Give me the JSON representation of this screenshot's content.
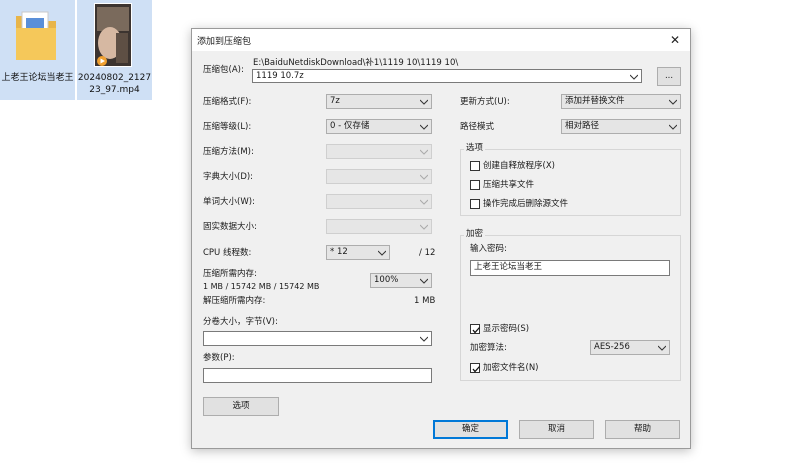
{
  "desktop": {
    "folder_name": "上老王论坛当老王",
    "video_name": "20240802_212723_97.mp4"
  },
  "dialog": {
    "title": "添加到压缩包",
    "archive_label": "压缩包(A):",
    "archive_path": "E:\\BaiduNetdiskDownload\\补1\\1119 10\\1119 10\\",
    "archive_name": "1119 10.7z",
    "browse_label": "...",
    "format_label": "压缩格式(F):",
    "format_value": "7z",
    "level_label": "压缩等级(L):",
    "level_value": "0 - 仅存储",
    "method_label": "压缩方法(M):",
    "dict_label": "字典大小(D):",
    "word_label": "单词大小(W):",
    "solid_label": "固实数据大小:",
    "cpu_label": "CPU 线程数:",
    "cpu_value": "* 12",
    "cpu_max": "/ 12",
    "mem_comp_label": "压缩所需内存:",
    "mem_comp_detail": "1 MB / 15742 MB / 15742 MB",
    "mem_percent": "100%",
    "mem_decomp_label": "解压缩所需内存:",
    "mem_decomp_value": "1 MB",
    "split_label": "分卷大小，字节(V):",
    "params_label": "参数(P):",
    "options_button": "选项",
    "update_label": "更新方式(U):",
    "update_value": "添加并替换文件",
    "path_label": "路径模式",
    "path_value": "相对路径",
    "options_group": "选项",
    "opt_sfx": "创建自释放程序(X)",
    "opt_shared": "压缩共享文件",
    "opt_delete": "操作完成后删除源文件",
    "encrypt_group": "加密",
    "password_label": "输入密码:",
    "password_value": "上老王论坛当老王",
    "show_password": "显示密码(S)",
    "enc_method_label": "加密算法:",
    "enc_method_value": "AES-256",
    "encrypt_names": "加密文件名(N)",
    "ok_button": "确定",
    "cancel_button": "取消",
    "help_button": "帮助",
    "close_glyph": "✕"
  }
}
